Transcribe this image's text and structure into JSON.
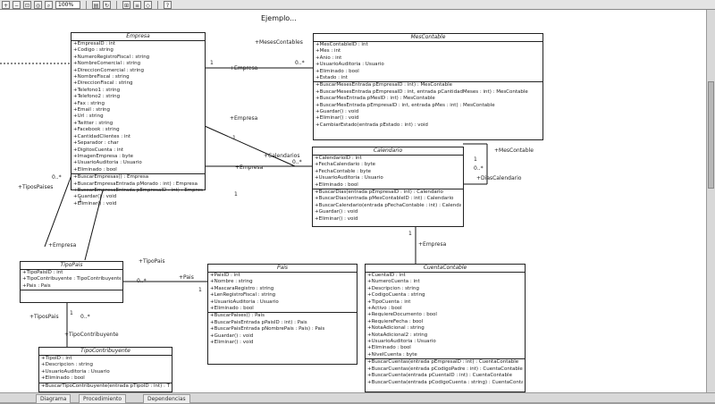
{
  "toolbar": {
    "zoom": "100%",
    "buttons": [
      "zoom-in",
      "zoom-out",
      "zoom-fit",
      "zoom-normal",
      "print",
      "refresh",
      "align-left",
      "align-center",
      "layout",
      "help"
    ]
  },
  "diagram_title": "Ejemplo...",
  "tabs": [
    "Diagrama",
    "Procedimiento",
    "Dependencias"
  ],
  "classes": {
    "empresa": {
      "name": "Empresa",
      "attributes": [
        "+EmpresaID : int",
        "+Codigo : string",
        "+NumeroRegistroFiscal : string",
        "+NombreComercial : string",
        "+DireccionComercial : string",
        "+NombreFiscal : string",
        "+DireccionFiscal : string",
        "+Telefono1 : string",
        "+Telefono2 : string",
        "+Fax : string",
        "+Email : string",
        "+Url : string",
        "+Twitter : string",
        "+Facebook : string",
        "+CantidadClientes : int",
        "+Separador : char",
        "+DigitosCuenta : int",
        "+ImagenEmpresa : byte",
        "+UsuarioAuditoria : Usuario",
        "+Eliminado : bool"
      ],
      "methods": [
        "+BuscarEmpresas() : Empresa",
        "+BuscarEmpresaEntrada pMorado : int) : Empresa",
        "+BuscarEmpresaEntrada pEmpresaID : int) : Empresa",
        "+Guardar() : void",
        "+Eliminar() : void"
      ]
    },
    "mescontable": {
      "name": "MesContable",
      "attributes": [
        "+MesContableID : int",
        "+Mes : int",
        "+Anio : int",
        "+UsuarioAuditoria : Usuario",
        "+Eliminado : bool",
        "+Estado : int"
      ],
      "methods": [
        "+BuscarMesesEntrada pEmpresaID : int) : MesContable",
        "+BuscarMesesEntrada pEmpresaID : int, entrada pCantidadMeses : int) : MesContable",
        "+BuscarMesEntrada pMesID : int) : MesContable",
        "+BuscarMesEntrada pEmpresaID : int, entrada pMes : int) : MesContable",
        "+Guardar() : void",
        "+Eliminar() : void",
        "+CambiarEstado(entrada pEstado : int) : void"
      ]
    },
    "calendario": {
      "name": "Calendario",
      "attributes": [
        "+CalendarioID : int",
        "+FechaCalendario : byte",
        "+FechaContable : byte",
        "+UsuarioAuditoria : Usuario",
        "+Eliminado : bool"
      ],
      "methods": [
        "+BuscarDias(entrada pEmpresaID : int) : Calendario",
        "+BuscarDias(entrada pMesContableID : int) : Calendario",
        "+BuscarCalendario(entrada pFechaContable : int) : Calendario",
        "+Guardar() : void",
        "+Eliminar() : void"
      ]
    },
    "tipopais": {
      "name": "TipoPais",
      "attributes": [
        "+TipoPaisID : int",
        "+TipoContribuyente : TipoContribuyente",
        "+Pais : Pais"
      ],
      "methods": []
    },
    "pais": {
      "name": "Pais",
      "attributes": [
        "+PaisID : int",
        "+Nombre : string",
        "+MascaraRegistro : string",
        "+LenRegistroFiscal : string",
        "+UsuarioAuditoria : Usuario",
        "+Eliminado : bool"
      ],
      "methods": [
        "+BuscarPaises() : Pais",
        "+BuscarPaisEntrada pPaisID : int) : Pais",
        "+BuscarPaisEntrada pNombrePais : Pais) : Pais",
        "+Guardar() : void",
        "+Eliminar() : void"
      ]
    },
    "cuentacontable": {
      "name": "CuentaContable",
      "attributes": [
        "+CuentaID : int",
        "+NumeroCuenta : int",
        "+Descripcion : string",
        "+CodigoCuenta : string",
        "+TipoCuenta : int",
        "+Activo : bool",
        "+RequiereDocumento : bool",
        "+RequiereFecha : bool",
        "+NotaAdicional : string",
        "+NotaAdicional2 : string",
        "+UsuarioAuditoria : Usuario",
        "+Eliminado : bool",
        "+NivelCuenta : byte"
      ],
      "methods": [
        "+BuscarCuentas(entrada pEmpresaID : int) : CuentaContable",
        "+BuscarCuentas(entrada pCodigoPadre : int) : CuentaContable",
        "+BuscarCuenta(entrada pCuentaID : int) : CuentaContable",
        "+BuscarCuenta(entrada pCodigoCuenta : string) : CuentaContable"
      ]
    },
    "tipocontribuyente": {
      "name": "TipoContribuyente",
      "attributes": [
        "+TipoID : int",
        "+Descripcion : string",
        "+UsuarioAuditoria : Usuario",
        "+Eliminado : bool"
      ],
      "methods": [
        "+BuscarTipoContribuyente(entrada pTipoID : int) : TipoContribuyente"
      ]
    }
  },
  "roles": {
    "empresa_mes": "+Empresa",
    "mes_empresa": "+MesesContables",
    "empresa_cal": "+Empresa",
    "cal_label": "+Calendarios",
    "cal_empresa": "+Empresa",
    "mes_cal": "+MesContable",
    "cal_mes": "+DiasCalendario",
    "tipopais_empresa": "+TiposPaises",
    "empresa_tipopais": "+Empresa",
    "tipopais_pais": "+TipoPais",
    "pais_tipopais": "+Pais",
    "tipopais_tc": "+TiposPais",
    "tc_tipopais": "+TipoContribuyente",
    "cal_cuenta": "+Empresa"
  },
  "multiplicities": {
    "m1": "1",
    "m2": "0..*",
    "m3": "1",
    "m4": "1",
    "m5": "0..*",
    "m6": "1",
    "m7": "0..*",
    "m8": "0..*",
    "m9": "1",
    "m10": "0..*",
    "m11": "1",
    "m12": "0..*",
    "m13": "1",
    "m14": "1"
  }
}
